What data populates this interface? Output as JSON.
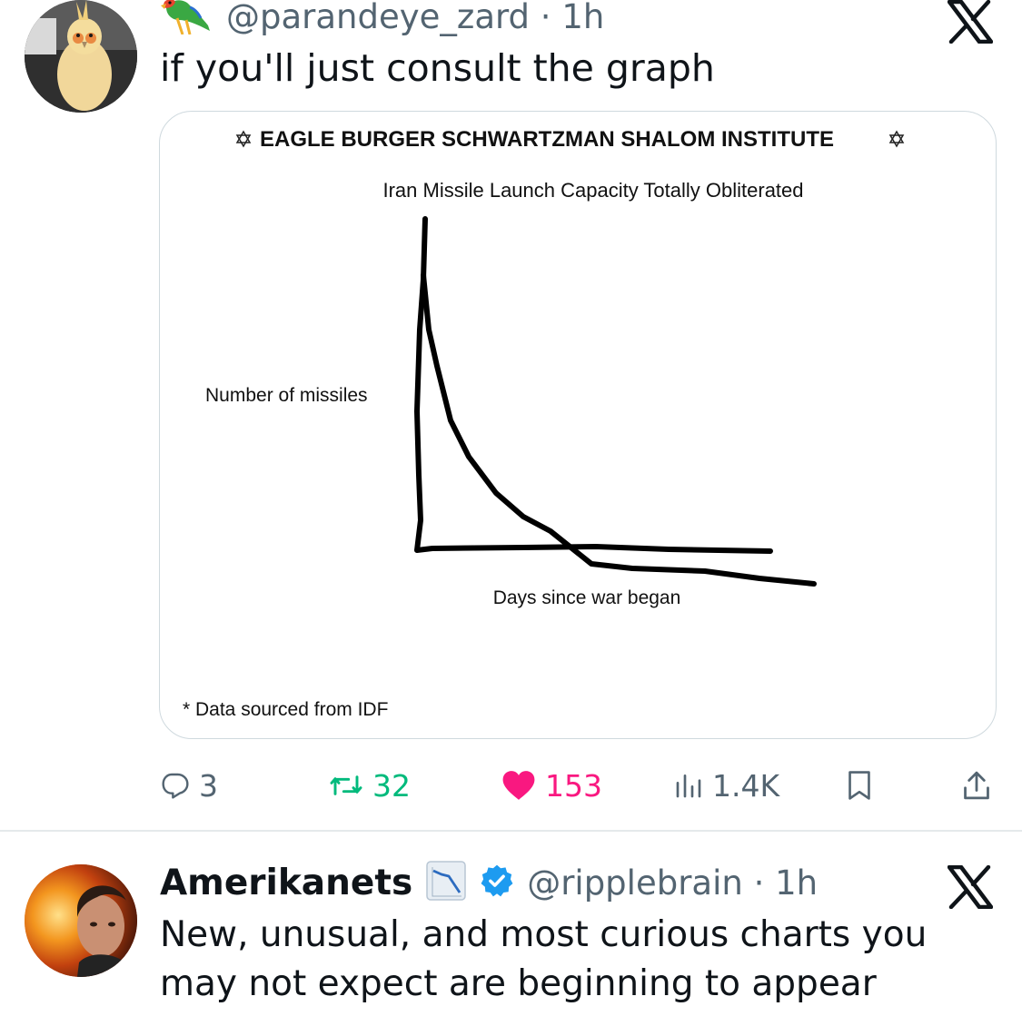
{
  "tweet1": {
    "handle": "@parandeye_zard · 1h",
    "emoji_icon": "parrot-emoji",
    "text": "if you'll just consult the graph",
    "image": {
      "institute": "EAGLE BURGER SCHWARTZMAN SHALOM INSTITUTE",
      "title": "Iran Missile Launch Capacity Totally Obliterated",
      "ylabel": "Number of missiles",
      "xlabel": "Days since war began",
      "footnote": "* Data sourced from IDF"
    },
    "stats": {
      "replies": "3",
      "reposts": "32",
      "likes": "153",
      "views": "1.4K"
    }
  },
  "tweet2": {
    "display_name": "Amerikanets",
    "name_emoji_icon": "chart-decreasing-emoji",
    "verified_icon": "verified-badge-icon",
    "handle": "@ripplebrain · 1h",
    "text": "New, unusual, and most curious charts you may not expect are beginning to appear"
  },
  "colors": {
    "text": "#0f1419",
    "secondary": "#536471",
    "repost": "#00ba7c",
    "like": "#f91880",
    "verified": "#1d9bf0",
    "border": "#cfd9de"
  }
}
